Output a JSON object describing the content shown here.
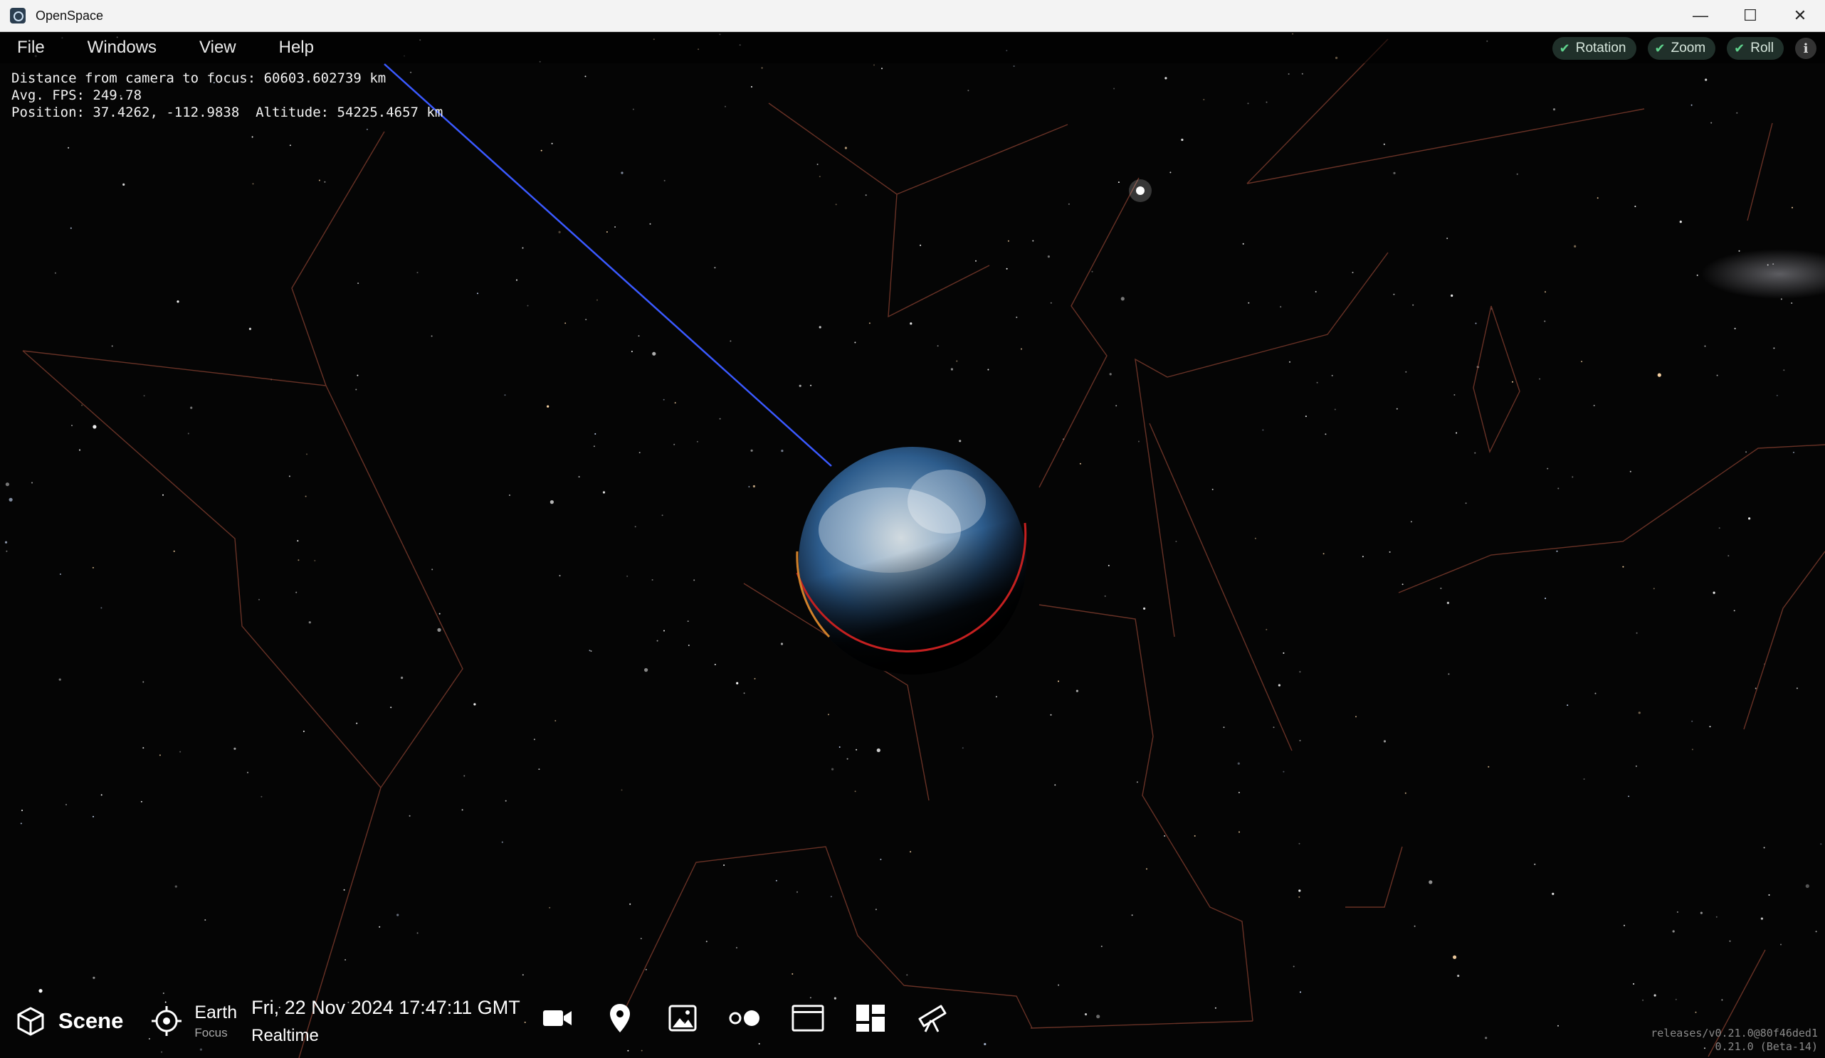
{
  "window": {
    "title": "OpenSpace"
  },
  "menu": {
    "items": [
      "File",
      "Windows",
      "View",
      "Help"
    ]
  },
  "camera_toggles": [
    {
      "label": "Rotation",
      "checked": true
    },
    {
      "label": "Zoom",
      "checked": true
    },
    {
      "label": "Roll",
      "checked": true
    }
  ],
  "stats": {
    "distance": "Distance from camera to focus: 60603.602739 km",
    "fps": "Avg. FPS: 249.78",
    "position": "Position: 37.4262, -112.9838  Altitude: 54225.4657 km"
  },
  "bottom": {
    "scene_label": "Scene",
    "focus_name": "Earth",
    "focus_sub": "Focus",
    "date": "Fri, 22 Nov 2024 17:47:11 GMT",
    "time_mode": "Realtime",
    "tools": [
      "camera-icon",
      "pin-icon",
      "image-icon",
      "dots-icon",
      "window-icon",
      "layout-icon",
      "telescope-icon"
    ]
  },
  "version": {
    "line1": "releases/v0.21.0@80f46ded1",
    "line2": "0.21.0 (Beta-14)"
  },
  "colors": {
    "accent": "#5fd38d",
    "trail": "#3a59ff",
    "orbit": "#cc2222"
  }
}
